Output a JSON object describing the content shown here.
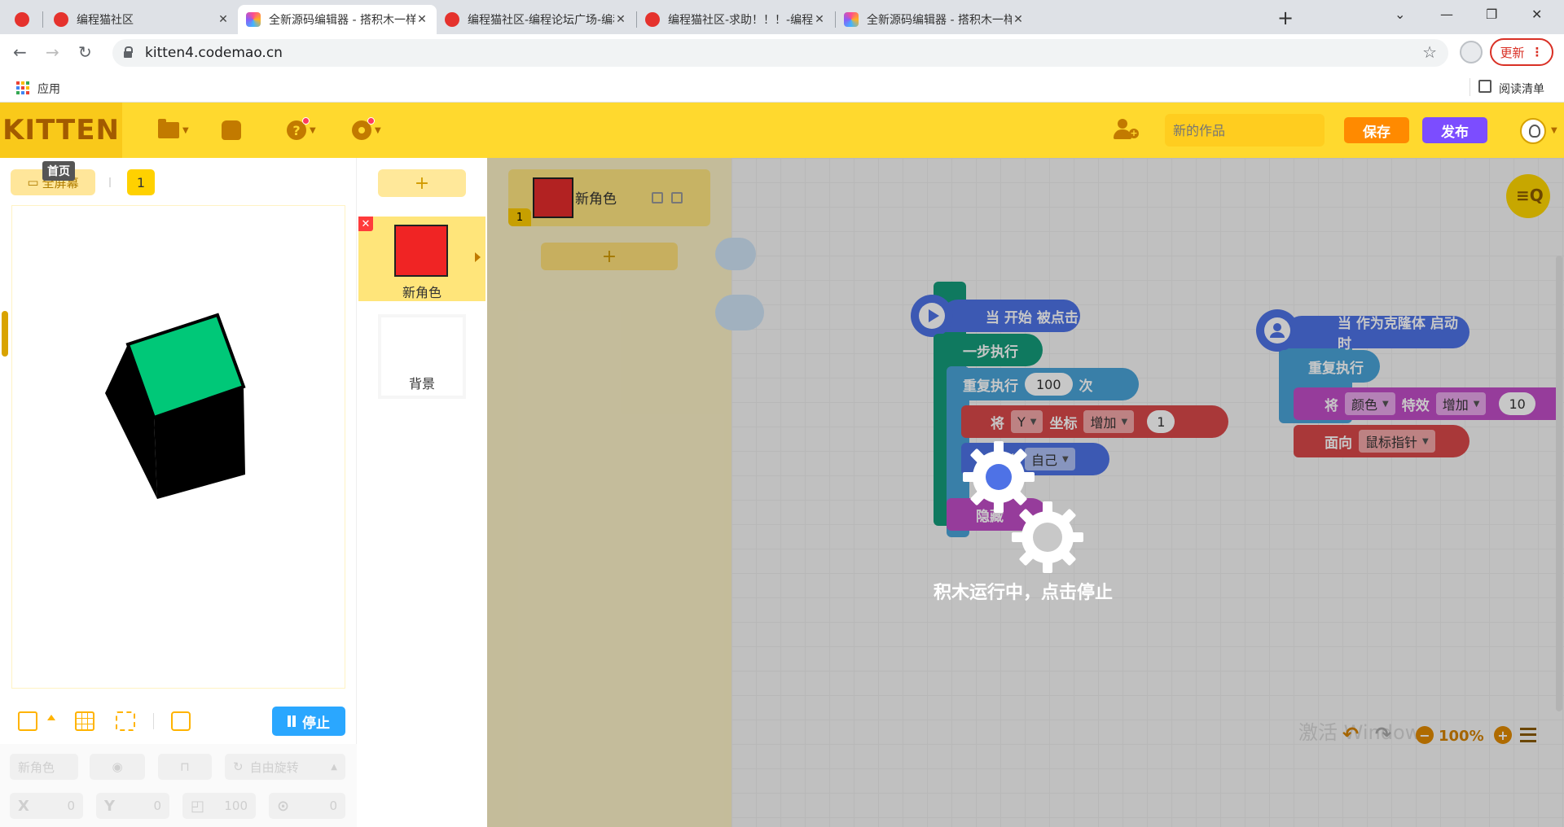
{
  "browser": {
    "tabs": [
      {
        "title": "",
        "favicon": "codemao-red"
      },
      {
        "title": "编程猫社区",
        "favicon": "codemao-red"
      },
      {
        "title": "全新源码编辑器 - 搭积木一样有趣",
        "favicon": "kitten"
      },
      {
        "title": "编程猫社区-编程论坛广场-编程学",
        "favicon": "codemao-red"
      },
      {
        "title": "编程猫社区-求助！！！-编程学习",
        "favicon": "codemao-red"
      },
      {
        "title": "全新源码编辑器 - 搭积木一样有趣",
        "favicon": "kitten"
      }
    ],
    "tab_close": "✕",
    "new_tab": "+",
    "url": "kitten4.codemao.cn",
    "update_label": "更新",
    "bookmarks": {
      "apps_label": "应用",
      "reading_list_label": "阅读清单"
    }
  },
  "app": {
    "logo": "KITTEN",
    "work_name_placeholder": "新的作品",
    "save_label": "保存",
    "publish_label": "发布",
    "stage": {
      "fullscreen_label": "全屏幕",
      "tooltip": "首页",
      "scene_number": "1",
      "stop_label": "停止"
    },
    "props": {
      "name_placeholder": "新角色",
      "rotation_label": "自由旋转",
      "x_label": "X",
      "x_value": "0",
      "y_label": "Y",
      "y_value": "0",
      "size_value": "100",
      "direction_value": "0"
    },
    "sprites": {
      "add": "+",
      "selected_name": "新角色",
      "background_name": "背景"
    },
    "costume": {
      "name": "新角色",
      "number": "1",
      "add": "+"
    },
    "blocks": {
      "hat1": "当 开始 被点击",
      "step": "一步执行",
      "repeat_label": "重复执行",
      "repeat_count": "100",
      "repeat_unit": "次",
      "set_label": "将",
      "set_axis": "Y",
      "set_coord": "坐标",
      "set_op": "增加",
      "set_value": "1",
      "clone_label": "克隆",
      "clone_target": "自己",
      "hide_label": "隐藏",
      "hat2": "当 作为克隆体 启动时",
      "repeat2_label": "重复执行",
      "effect_set": "将",
      "effect_prop": "颜色",
      "effect_label": "特效",
      "effect_op": "增加",
      "effect_value": "10",
      "face_label": "面向",
      "face_target": "鼠标指针"
    },
    "overlay_text": "积木运行中，点击停止",
    "zoom": "100%",
    "watermark": "激活 Windows"
  },
  "colors": {
    "topbar": "#ffd92e",
    "save": "#ff8a00",
    "publish": "#7c4dff",
    "stop": "#2aa7ff",
    "event_block": "#4e72e6",
    "control_block": "#149c7a",
    "repeat_block": "#4aa3d8",
    "motion_block": "#d9484a",
    "look_block": "#c04ec7",
    "cube_face": "#00c878"
  }
}
